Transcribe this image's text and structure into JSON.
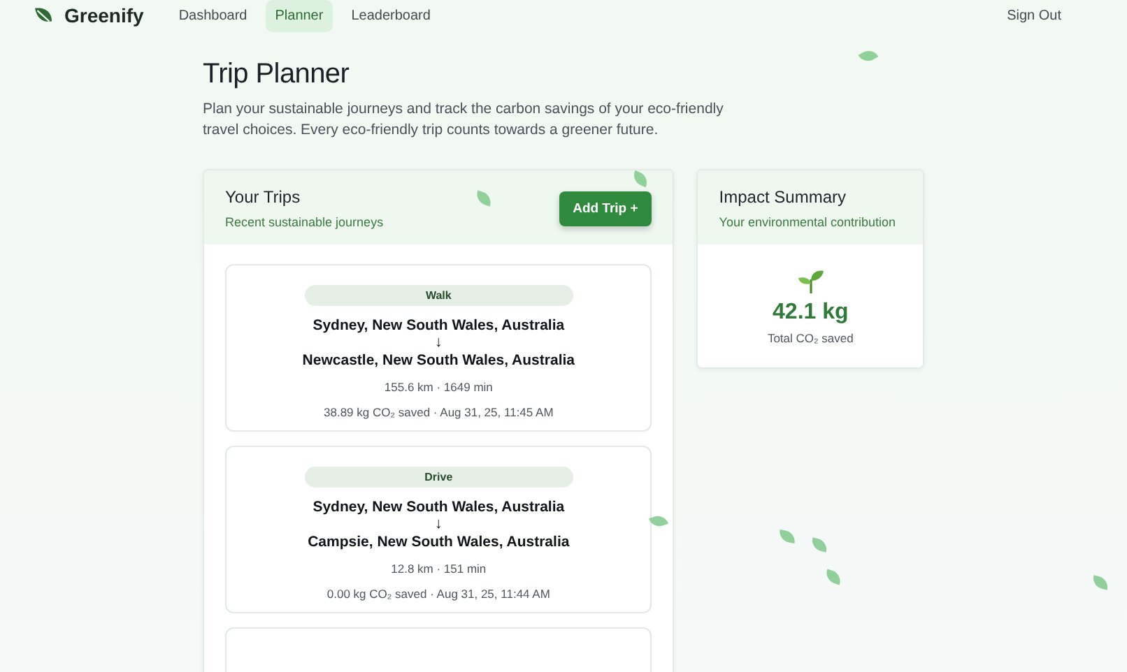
{
  "brand": {
    "name": "Greenify"
  },
  "nav": [
    {
      "label": "Dashboard",
      "selected": false
    },
    {
      "label": "Planner",
      "selected": true
    },
    {
      "label": "Leaderboard",
      "selected": false
    }
  ],
  "sign_out": "Sign Out",
  "page": {
    "title": "Trip Planner",
    "description": "Plan your sustainable journeys and track the carbon savings of your eco-friendly travel choices. Every eco-friendly trip counts towards a greener future."
  },
  "trips_panel": {
    "title": "Your Trips",
    "subtitle": "Recent sustainable journeys",
    "add_button": "Add Trip +",
    "trips": [
      {
        "mode": "Walk",
        "from": "Sydney, New South Wales, Australia",
        "arrow": "↓",
        "to": "Newcastle, New South Wales, Australia",
        "stats": "155.6 km · 1649 min",
        "saved": "38.89 kg CO₂ saved · Aug 31, 25, 11:45 AM"
      },
      {
        "mode": "Drive",
        "from": "Sydney, New South Wales, Australia",
        "arrow": "↓",
        "to": "Campsie, New South Wales, Australia",
        "stats": "12.8 km · 151 min",
        "saved": "0.00 kg CO₂ saved · Aug 31, 25, 11:44 AM"
      }
    ]
  },
  "impact": {
    "title": "Impact Summary",
    "subtitle": "Your environmental contribution",
    "value": "42.1 kg",
    "label": "Total CO₂ saved"
  }
}
